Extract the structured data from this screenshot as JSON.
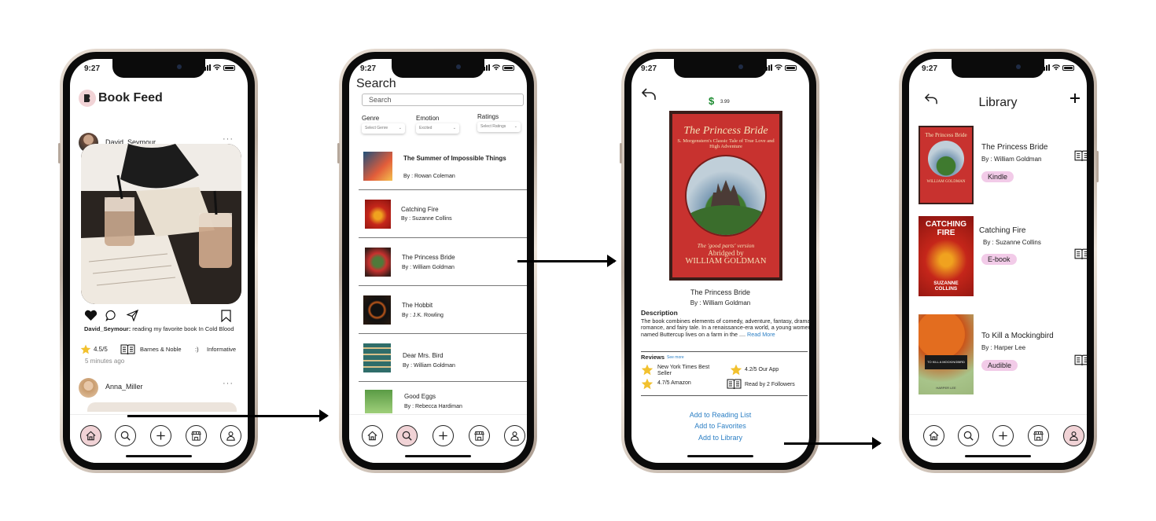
{
  "status": {
    "time": "9:27"
  },
  "feed": {
    "title": "Book Feed",
    "post1": {
      "user": "David_Seymour",
      "caption_user": "David_Seymour:",
      "caption": " reading my favorite book In Cold Blood",
      "rating": "4.5/5",
      "store": "Barnes & Noble",
      "emoticon": ":)",
      "mood": "Informative",
      "time_ago": "5 minutes ago"
    },
    "post2": {
      "user": "Anna_Miller"
    }
  },
  "search": {
    "title": "Search",
    "placeholder": "Search",
    "filters": [
      {
        "label": "Genre",
        "value": "Select Genre"
      },
      {
        "label": "Emotion",
        "value": "Excited"
      },
      {
        "label": "Ratings",
        "value": "Select Ratings"
      }
    ],
    "results": [
      {
        "title": "The Summer of Impossible Things",
        "author": "By : Rowan Coleman"
      },
      {
        "title": "Catching Fire",
        "author": "By : Suzanne Collins"
      },
      {
        "title": "The Princess Bride",
        "author": "By : William Goldman"
      },
      {
        "title": "The Hobbit",
        "author": "By : J.K. Rowling"
      },
      {
        "title": "Dear Mrs. Bird",
        "author": "By : William Goldman"
      },
      {
        "title": "Good Eggs",
        "author": "By : Rebecca Hardiman"
      }
    ]
  },
  "detail": {
    "currency": "$",
    "price": "3.99",
    "cover": {
      "title": "The Princess Bride",
      "subtitle": "S. Morgenstern's Classic Tale of True Love and High Adventure",
      "edition": "The 'good parts' version",
      "abridged": "Abridged by",
      "author": "WILLIAM GOLDMAN"
    },
    "title": "The Princess Bride",
    "author": "By : William Goldman",
    "description_label": "Description",
    "description": "The book combines elements of comedy, adventure, fantasy, drama, romance, and fairy tale.  In a renaissance-era world, a young women named Buttercup lives on a farm in the ....",
    "read_more": "Read More",
    "reviews_label": "Reviews",
    "see_more": "See more",
    "review1": "New York Times Best Seller",
    "review2": "4.2/5 Our App",
    "review3": "4.7/5 Amazon",
    "review4": "Read by 2 Followers",
    "actions": [
      "Add to Reading List",
      "Add to Favorites",
      "Add to Library"
    ]
  },
  "library": {
    "title": "Library",
    "items": [
      {
        "title": "The Princess Bride",
        "author": "By : William Goldman",
        "format": "Kindle"
      },
      {
        "title": "Catching Fire",
        "author": "By : Suzanne Collins",
        "format": "E-book",
        "cover_title": "CATCHING FIRE",
        "cover_author": "SUZANNE COLLINS"
      },
      {
        "title": "To Kill a Mockingbird",
        "author": "By : Harper Lee",
        "format": "Audible",
        "cover_title": "TO KILL A MOCKINGBIRD",
        "cover_author": "HARPER LEE"
      }
    ]
  },
  "colors": {
    "accent_pink": "#f1d3d6",
    "pill_pink": "#f2cbe8",
    "link_blue": "#2c7fc4",
    "star": "#f2c12e"
  }
}
